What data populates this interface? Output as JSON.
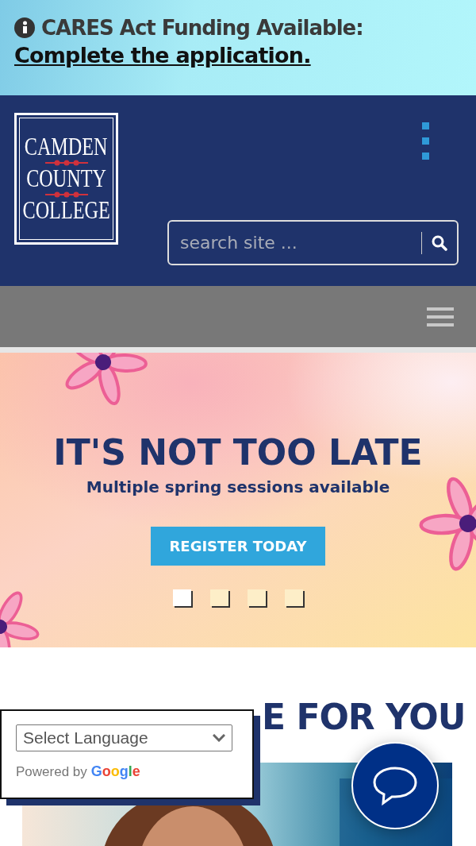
{
  "alert": {
    "title": "CARES Act Funding Available:",
    "link": "Complete the application."
  },
  "header": {
    "logo_lines": [
      "CAMDEN",
      "COUNTY",
      "COLLEGE"
    ],
    "search": {
      "placeholder": "search site ..."
    }
  },
  "hero": {
    "title": "IT'S NOT TOO LATE",
    "subtitle": "Multiple spring sessions available",
    "button": "REGISTER TODAY",
    "dots": [
      {
        "selected": true
      },
      {
        "selected": false
      },
      {
        "selected": false
      },
      {
        "selected": false
      }
    ]
  },
  "section": {
    "heading": "E FOR YOU"
  },
  "language_widget": {
    "select": "Select Language",
    "powered_by": "Powered by",
    "brand": [
      "G",
      "o",
      "o",
      "g",
      "l",
      "e"
    ]
  }
}
